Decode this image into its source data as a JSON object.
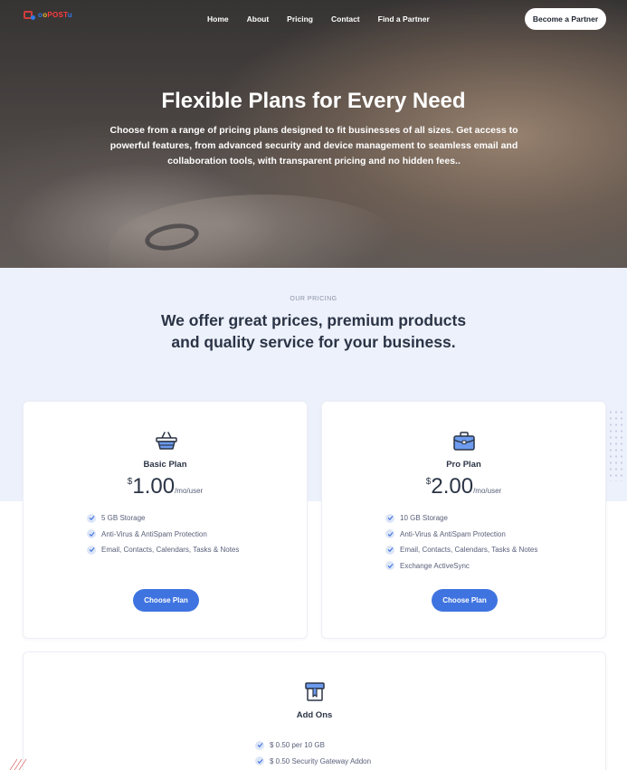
{
  "nav": {
    "logo": {
      "part1": "o",
      "part2": "o",
      "part3": "POST",
      "part4": "u"
    },
    "links": [
      "Home",
      "About",
      "Pricing",
      "Contact",
      "Find a Partner"
    ],
    "cta": "Become a Partner"
  },
  "hero": {
    "title": "Flexible Plans for Every Need",
    "subtitle": "Choose from a range of pricing plans designed to fit businesses of all sizes. Get access to powerful features, from advanced security and device management to seamless email and collaboration tools, with transparent pricing and no hidden fees.."
  },
  "pricing": {
    "eyebrow": "OUR PRICING",
    "title_line1": "We offer great prices, premium products",
    "title_line2": "and quality service for your business.",
    "plans": [
      {
        "icon": "basket-icon",
        "name": "Basic Plan",
        "currency": "$",
        "amount": "1.00",
        "period": "/mo/user",
        "features": [
          "5 GB Storage",
          "Anti-Virus & AntiSpam Protection",
          "Email, Contacts, Calendars, Tasks & Notes"
        ],
        "button": "Choose Plan"
      },
      {
        "icon": "briefcase-icon",
        "name": "Pro Plan",
        "currency": "$",
        "amount": "2.00",
        "period": "/mo/user",
        "features": [
          "10 GB Storage",
          "Anti-Virus & AntiSpam Protection",
          "Email, Contacts, Calendars, Tasks & Notes",
          "Exchange ActiveSync"
        ],
        "button": "Choose Plan"
      }
    ],
    "addons": {
      "icon": "gift-box-icon",
      "name": "Add Ons",
      "features": [
        "$ 0.50 per 10 GB",
        "$ 0.50 Security Gateway Addon"
      ]
    }
  },
  "colors": {
    "accent": "#3f74e0",
    "section_bg": "#edf1fc",
    "heading": "#2b3445"
  }
}
